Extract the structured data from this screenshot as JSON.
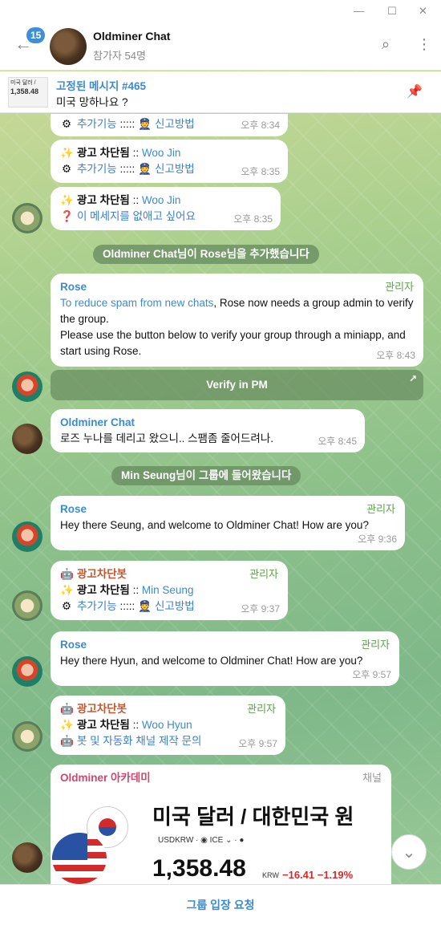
{
  "window": {
    "minimize": "—",
    "maximize": "☐",
    "close": "✕"
  },
  "header": {
    "unread_count": "15",
    "title": "Oldminer Chat",
    "subtitle": "참가자 54명"
  },
  "pinned": {
    "thumb_line1": "미국 달러 / ",
    "thumb_line2": "1,358.48",
    "title": "고정된 메시지 #465",
    "text": "미국 망하나요 ?"
  },
  "messages": {
    "m1": {
      "line": "추가기능",
      "sep": ":::::",
      "report": "신고방법",
      "time": "오후 8:34"
    },
    "m2": {
      "blocked": "광고 차단됨",
      "sep2": "::",
      "user": "Woo Jin",
      "line": "추가기능",
      "sep": ":::::",
      "report": "신고방법",
      "time": "오후 8:35"
    },
    "m3": {
      "blocked": "광고 차단됨",
      "sep2": "::",
      "user": "Woo Jin",
      "question": "이 메세지를 없애고 싶어요",
      "time": "오후 8:35"
    },
    "service1": {
      "actor": "Oldminer Chat",
      "text1": "님이 ",
      "target": "Rose",
      "text2": "님을 추가했습니다"
    },
    "m4": {
      "sender": "Rose",
      "badge": "관리자",
      "link": "To reduce spam from new chats",
      "text1": ", Rose now needs a group admin to verify the group.",
      "text2": "Please use the button below to verify your group through a miniapp, and start using Rose.",
      "time": "오후 8:43",
      "button": "Verify in PM",
      "button_arrow": "↗"
    },
    "m5": {
      "sender": "Oldminer Chat",
      "text": "로즈 누나를 데리고 왔으니.. 스팸좀 줄어드려나.",
      "time": "오후 8:45"
    },
    "service2": {
      "actor": "Min Seung",
      "text": "님이 그룹에 들어왔습니다"
    },
    "m6": {
      "sender": "Rose",
      "badge": "관리자",
      "text": "Hey there Seung, and welcome to Oldminer Chat! How are you?",
      "time": "오후 9:36"
    },
    "m7": {
      "sender": "광고차단봇",
      "badge": "관리자",
      "blocked": "광고 차단됨",
      "sep2": "::",
      "user": "Min Seung",
      "line": "추가기능",
      "sep": ":::::",
      "report": "신고방법",
      "time": "오후 9:37"
    },
    "m8": {
      "sender": "Rose",
      "badge": "관리자",
      "text": "Hey there Hyun, and welcome to Oldminer Chat! How are you?",
      "time": "오후 9:57"
    },
    "m9": {
      "sender": "광고차단봇",
      "badge": "관리자",
      "blocked": "광고 차단됨",
      "sep2": "::",
      "user": "Woo Hyun",
      "line": "봇 및 자동화 채널 제작 문의",
      "time": "오후 9:57"
    },
    "m10": {
      "sender": "Oldminer 아카데미",
      "badge": "채널",
      "card_title": "미국 달러 / 대한민국 원",
      "ticker": "USDKRW · ◉ ICE ⌄ · ●",
      "price": "1,358.48",
      "unit": "KRW",
      "change": "−16.41  −1.19%"
    }
  },
  "join_button": "그룹 입장 요청",
  "colors": {
    "accent": "#3a8bd1",
    "admin_badge": "#5aa545",
    "negative": "#d62b2b",
    "service_bg": "#688c60"
  }
}
